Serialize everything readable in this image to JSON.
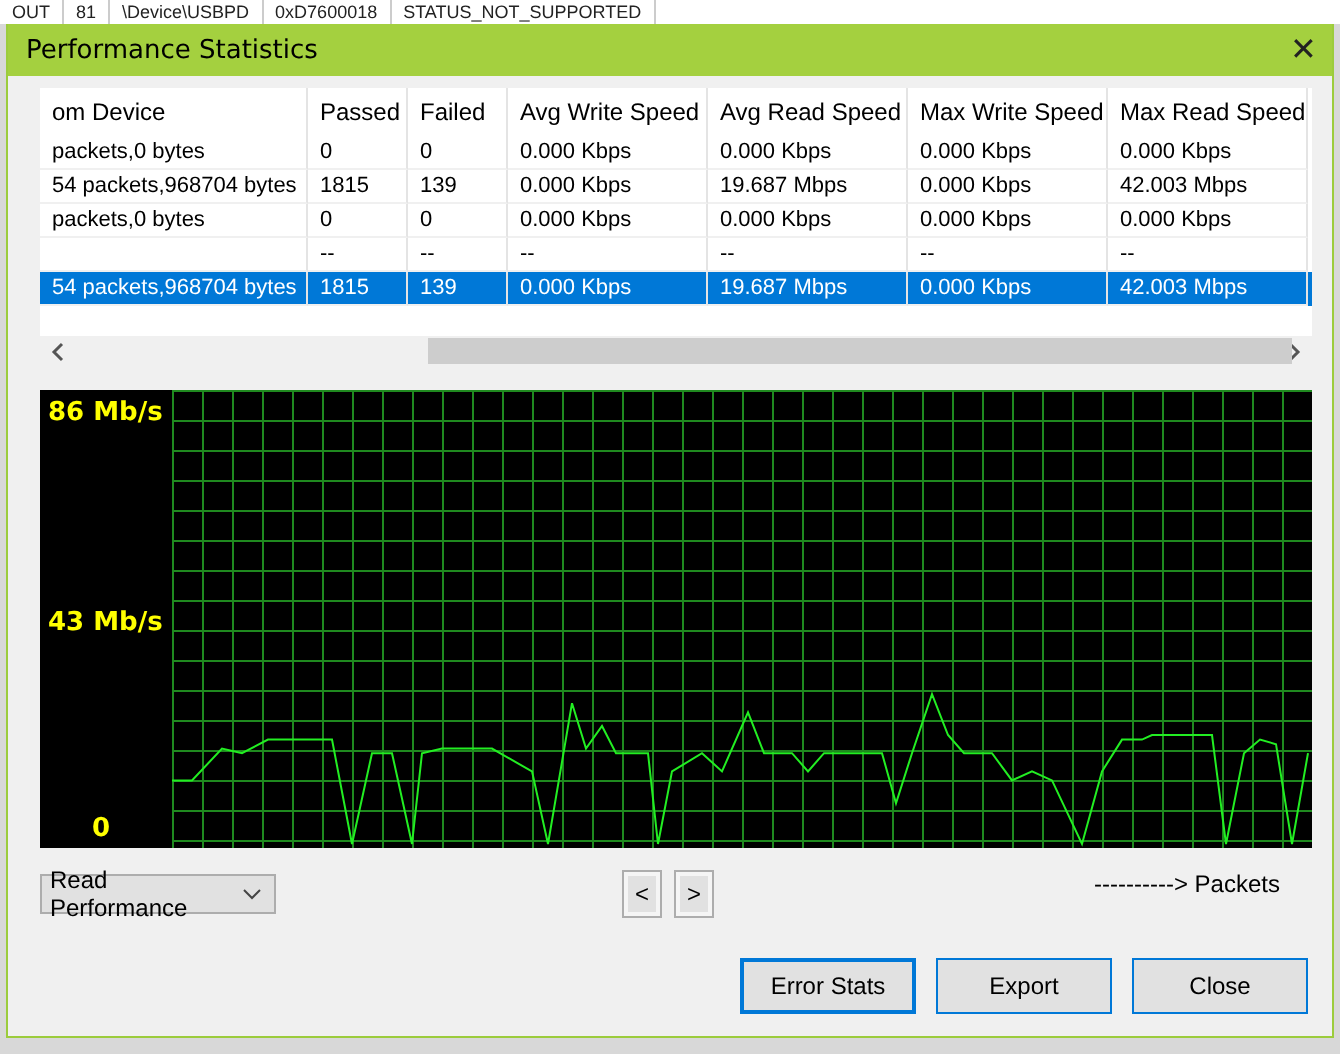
{
  "background_row": [
    "OUT",
    "81",
    "\\Device\\USBPD",
    "0xD7600018",
    "STATUS_NOT_SUPPORTED"
  ],
  "window": {
    "title": "Performance Statistics",
    "close": "✕"
  },
  "table": {
    "columns": [
      "om Device",
      "Passed",
      "Failed",
      "Avg Write Speed",
      "Avg Read Speed",
      "Max Write Speed",
      "Max Read Speed"
    ],
    "rows": [
      {
        "cells": [
          "packets,0 bytes",
          "0",
          "0",
          "0.000 Kbps",
          "0.000 Kbps",
          "0.000 Kbps",
          "0.000 Kbps"
        ],
        "selected": false
      },
      {
        "cells": [
          "54 packets,968704 bytes",
          "1815",
          "139",
          "0.000 Kbps",
          "19.687 Mbps",
          "0.000 Kbps",
          "42.003 Mbps"
        ],
        "selected": false
      },
      {
        "cells": [
          "packets,0 bytes",
          "0",
          "0",
          "0.000 Kbps",
          "0.000 Kbps",
          "0.000 Kbps",
          "0.000 Kbps"
        ],
        "selected": false
      },
      {
        "cells": [
          "",
          "--",
          "--",
          "--",
          "--",
          "--",
          "--"
        ],
        "selected": false
      },
      {
        "cells": [
          "54 packets,968704 bytes",
          "1815",
          "139",
          "0.000 Kbps",
          "19.687 Mbps",
          "0.000 Kbps",
          "42.003 Mbps"
        ],
        "selected": true
      }
    ]
  },
  "graph": {
    "y_labels": [
      "86 Mb/s",
      "43 Mb/s",
      "0"
    ],
    "x_label": "----------> Packets"
  },
  "mode_select": {
    "value": "Read Performance"
  },
  "nav": [
    "<",
    ">"
  ],
  "buttons": [
    {
      "label": "Error Stats",
      "kind": "default"
    },
    {
      "label": "Export",
      "kind": "normal"
    },
    {
      "label": "Close",
      "kind": "normal"
    }
  ]
}
